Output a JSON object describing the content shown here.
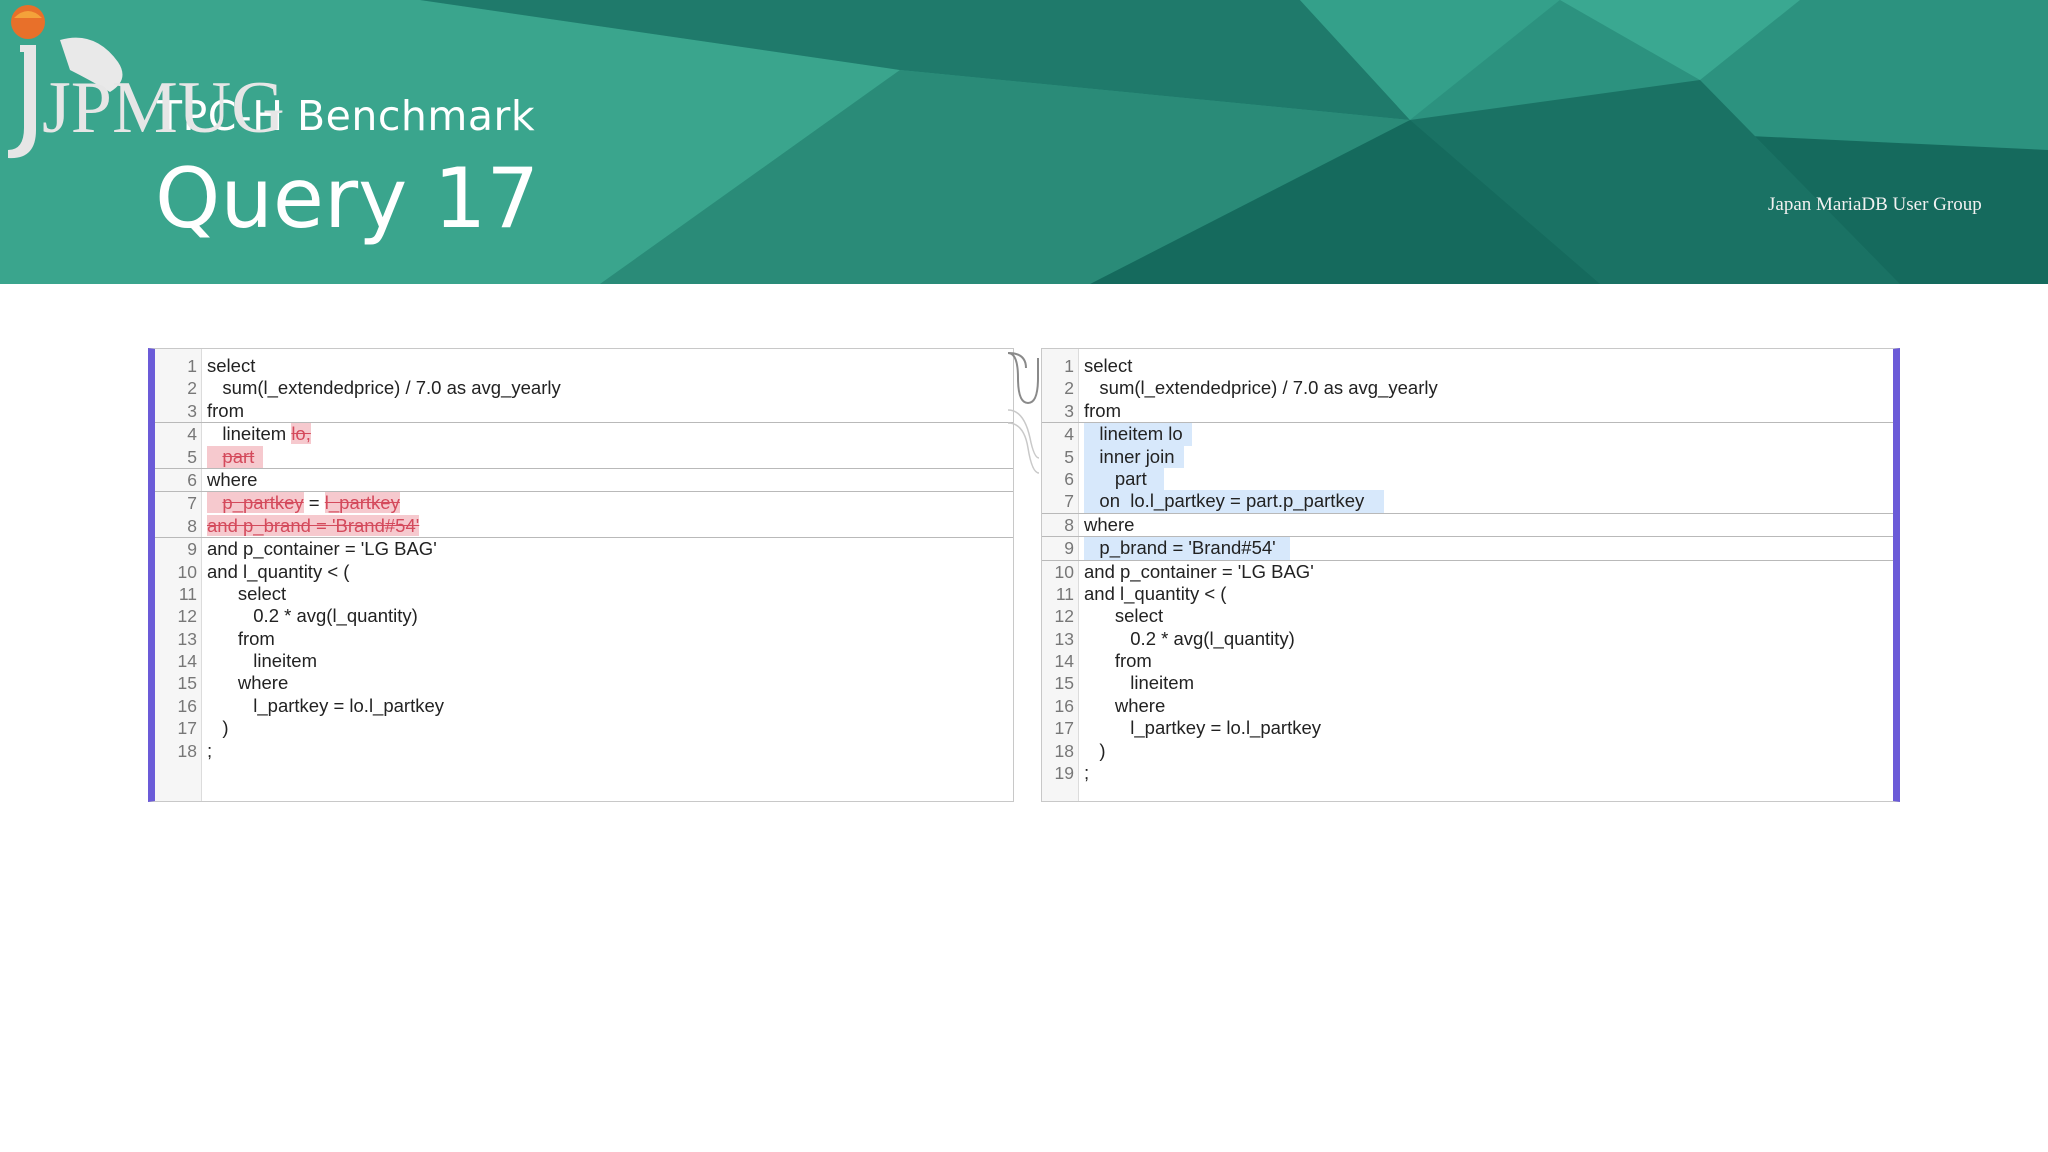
{
  "header": {
    "subtitle": "TPC-H Benchmark",
    "title": "Query 17",
    "logo_text": "JPMUG",
    "logo_tagline": "Japan MariaDB User Group"
  },
  "left_pane": {
    "lines": [
      {
        "n": "1",
        "t": "select"
      },
      {
        "n": "2",
        "t": "   sum(l_extendedprice) / 7.0 as avg_yearly"
      },
      {
        "n": "3",
        "t": "from"
      },
      {
        "n": "4",
        "t": "   lineitem ",
        "d": "lo,"
      },
      {
        "n": "5",
        "t": "   ",
        "d": "part"
      },
      {
        "n": "6",
        "t": "where"
      },
      {
        "n": "7",
        "t": "   ",
        "d": "p_partkey",
        "m": " = ",
        "d2": "l_partkey"
      },
      {
        "n": "8",
        "t": "",
        "d": "and p_brand = 'Brand#54'"
      },
      {
        "n": "9",
        "t": "and p_container = 'LG BAG'"
      },
      {
        "n": "10",
        "t": "and l_quantity < ("
      },
      {
        "n": "11",
        "t": "      select"
      },
      {
        "n": "12",
        "t": "         0.2 * avg(l_quantity)"
      },
      {
        "n": "13",
        "t": "      from"
      },
      {
        "n": "14",
        "t": "         lineitem"
      },
      {
        "n": "15",
        "t": "      where"
      },
      {
        "n": "16",
        "t": "         l_partkey = lo.l_partkey"
      },
      {
        "n": "17",
        "t": "   )"
      },
      {
        "n": "18",
        "t": ";"
      }
    ]
  },
  "right_pane": {
    "lines": [
      {
        "n": "1",
        "t": "select"
      },
      {
        "n": "2",
        "t": "   sum(l_extendedprice) / 7.0 as avg_yearly"
      },
      {
        "n": "3",
        "t": "from"
      },
      {
        "n": "4",
        "t": "   lineitem lo"
      },
      {
        "n": "5",
        "t": "   inner join"
      },
      {
        "n": "6",
        "t": "      part"
      },
      {
        "n": "7",
        "t": "   on  lo.l_partkey = part.p_partkey"
      },
      {
        "n": "8",
        "t": "where"
      },
      {
        "n": "9",
        "t": "   p_brand = 'Brand#54'"
      },
      {
        "n": "10",
        "t": "and p_container = 'LG BAG'"
      },
      {
        "n": "11",
        "t": "and l_quantity < ("
      },
      {
        "n": "12",
        "t": "      select"
      },
      {
        "n": "13",
        "t": "         0.2 * avg(l_quantity)"
      },
      {
        "n": "14",
        "t": "      from"
      },
      {
        "n": "15",
        "t": "         lineitem"
      },
      {
        "n": "16",
        "t": "      where"
      },
      {
        "n": "17",
        "t": "         l_partkey = lo.l_partkey"
      },
      {
        "n": "18",
        "t": "   )"
      },
      {
        "n": "19",
        "t": ";"
      }
    ]
  },
  "colors": {
    "banner": "#2b8f7c",
    "deleted": "#f6c9ce",
    "added": "#d7e8fb",
    "accent": "#6b5bd8"
  }
}
